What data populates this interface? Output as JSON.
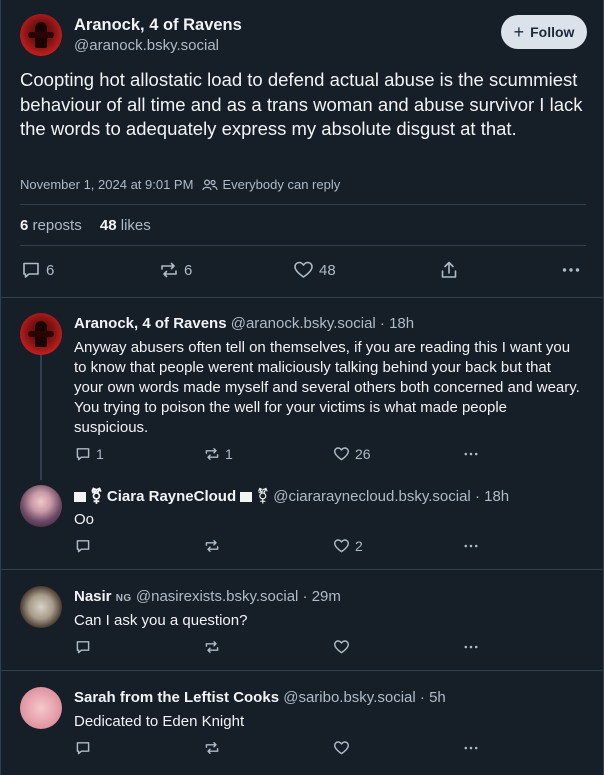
{
  "main_post": {
    "author_name": "Aranock, 4 of Ravens",
    "author_handle": "@aranock.bsky.social",
    "follow_label": "Follow",
    "text": "Coopting hot allostatic load to defend actual abuse is the scummiest behaviour of all time and as a trans woman and abuse survivor I lack the words to adequately express my absolute disgust at that.",
    "timestamp": "November 1, 2024 at 9:01 PM",
    "reply_setting": "Everybody can reply",
    "reposts_count": "6",
    "reposts_label": "reposts",
    "likes_count": "48",
    "likes_label": "likes",
    "actions": {
      "replies": "6",
      "reposts": "6",
      "likes": "48"
    }
  },
  "replies": [
    {
      "author_name": "Aranock, 4 of Ravens",
      "author_handle": "@aranock.bsky.social",
      "time": "18h",
      "text": "Anyway abusers often tell on themselves, if you are reading this I want you to know that people werent maliciously talking behind your back but that your own words made myself and several others both concerned and weary. You trying to poison the well for your victims is what made people suspicious.",
      "replies": "1",
      "reposts": "1",
      "likes": "26"
    },
    {
      "author_name": "Ciara RayneCloud",
      "author_handle": "@ciararaynecloud.bsky.social",
      "time": "18h",
      "text": "Oo",
      "replies": "",
      "reposts": "",
      "likes": "2"
    },
    {
      "author_name": "Nasir",
      "author_badge": "NG",
      "author_handle": "@nasirexists.bsky.social",
      "time": "29m",
      "text": "Can I ask you a question?",
      "replies": "",
      "reposts": "",
      "likes": ""
    },
    {
      "author_name": "Sarah from the Leftist Cooks",
      "author_handle": "@saribo.bsky.social",
      "time": "5h",
      "text": "Dedicated to Eden Knight",
      "replies": "",
      "reposts": "",
      "likes": ""
    }
  ],
  "separator": "·",
  "icons": [
    "reply-icon",
    "repost-icon",
    "like-icon",
    "share-icon",
    "more-icon",
    "people-icon",
    "plus-icon"
  ],
  "colors": {
    "background": "#161e27",
    "border": "#2e4052",
    "text": "#f1f3f5",
    "muted": "#aebbc9",
    "follow_bg": "#dce2ea"
  }
}
